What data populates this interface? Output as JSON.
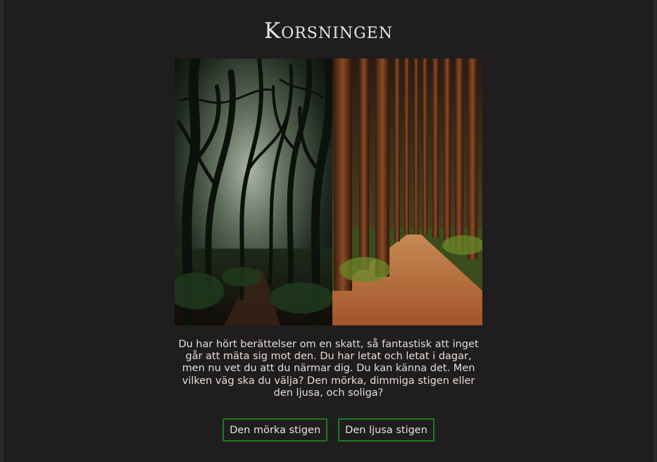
{
  "page": {
    "title": "Korsningen",
    "image_alt": "A dark misty forest path beside a bright sunlit forest path",
    "story": "Du har hört berättelser om en skatt, så fantastisk att inget går att mäta sig mot den. Du har letat och letat i dagar, men nu vet du att du närmar dig. Du kan känna det. Men vilken väg ska du välja? Den mörka, dimmiga stigen eller den ljusa, och soliga?"
  },
  "choices": {
    "dark_label": "Den mörka stigen",
    "light_label": "Den ljusa stigen"
  },
  "colors": {
    "page_bg": "#1f1d1d",
    "text": "#e3ded6",
    "button_border": "#1c7a1c"
  }
}
